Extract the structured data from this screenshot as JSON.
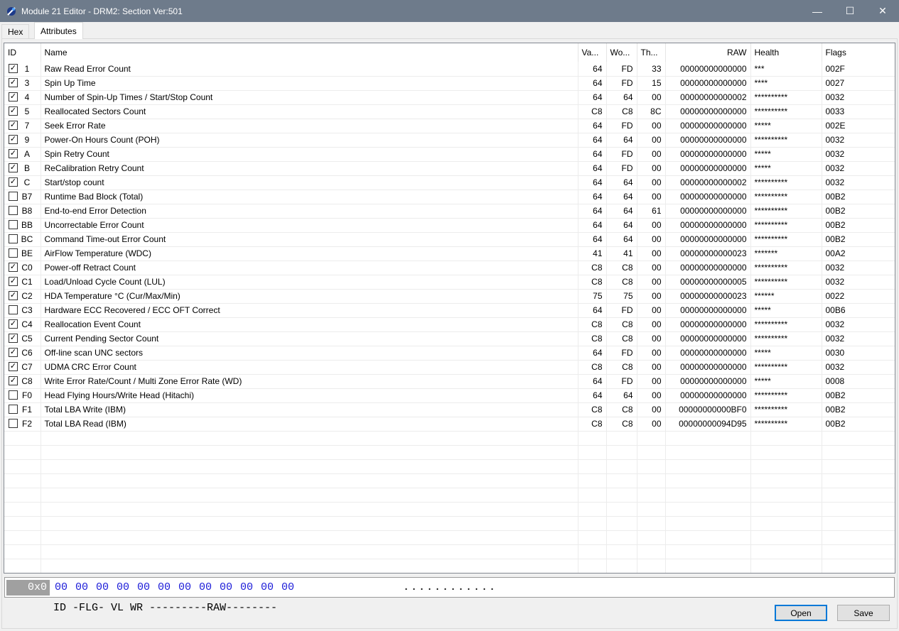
{
  "window": {
    "title": "Module 21 Editor - DRM2: Section Ver:501",
    "minimize": "—",
    "maximize": "☐",
    "close": "✕"
  },
  "tabs": [
    {
      "label": "Hex",
      "active": false
    },
    {
      "label": "Attributes",
      "active": true
    }
  ],
  "columns": {
    "id": "ID",
    "name": "Name",
    "value": "Va...",
    "worst": "Wo...",
    "threshold": "Th...",
    "raw": "RAW",
    "health": "Health",
    "flags": "Flags"
  },
  "rows": [
    {
      "checked": true,
      "id": "1",
      "name": "Raw Read Error Count",
      "va": "64",
      "wo": "FD",
      "th": "33",
      "raw": "00000000000000",
      "health": "***",
      "flags": "002F"
    },
    {
      "checked": true,
      "id": "3",
      "name": "Spin Up Time",
      "va": "64",
      "wo": "FD",
      "th": "15",
      "raw": "00000000000000",
      "health": "****",
      "flags": "0027"
    },
    {
      "checked": true,
      "id": "4",
      "name": "Number of Spin-Up Times / Start/Stop Count",
      "va": "64",
      "wo": "64",
      "th": "00",
      "raw": "00000000000002",
      "health": "**********",
      "flags": "0032"
    },
    {
      "checked": true,
      "id": "5",
      "name": "Reallocated Sectors Count",
      "va": "C8",
      "wo": "C8",
      "th": "8C",
      "raw": "00000000000000",
      "health": "**********",
      "flags": "0033"
    },
    {
      "checked": true,
      "id": "7",
      "name": "Seek Error Rate",
      "va": "64",
      "wo": "FD",
      "th": "00",
      "raw": "00000000000000",
      "health": "*****",
      "flags": "002E"
    },
    {
      "checked": true,
      "id": "9",
      "name": "Power-On Hours Count (POH)",
      "va": "64",
      "wo": "64",
      "th": "00",
      "raw": "00000000000000",
      "health": "**********",
      "flags": "0032"
    },
    {
      "checked": true,
      "id": "A",
      "name": "Spin Retry Count",
      "va": "64",
      "wo": "FD",
      "th": "00",
      "raw": "00000000000000",
      "health": "*****",
      "flags": "0032"
    },
    {
      "checked": true,
      "id": "B",
      "name": "ReCalibration Retry Count",
      "va": "64",
      "wo": "FD",
      "th": "00",
      "raw": "00000000000000",
      "health": "*****",
      "flags": "0032"
    },
    {
      "checked": true,
      "id": "C",
      "name": "Start/stop count",
      "va": "64",
      "wo": "64",
      "th": "00",
      "raw": "00000000000002",
      "health": "**********",
      "flags": "0032"
    },
    {
      "checked": false,
      "id": "B7",
      "name": "Runtime Bad Block (Total)",
      "va": "64",
      "wo": "64",
      "th": "00",
      "raw": "00000000000000",
      "health": "**********",
      "flags": "00B2"
    },
    {
      "checked": false,
      "id": "B8",
      "name": "End-to-end Error Detection",
      "va": "64",
      "wo": "64",
      "th": "61",
      "raw": "00000000000000",
      "health": "**********",
      "flags": "00B2"
    },
    {
      "checked": false,
      "id": "BB",
      "name": "Uncorrectable Error Count",
      "va": "64",
      "wo": "64",
      "th": "00",
      "raw": "00000000000000",
      "health": "**********",
      "flags": "00B2"
    },
    {
      "checked": false,
      "id": "BC",
      "name": "Command Time-out Error Count",
      "va": "64",
      "wo": "64",
      "th": "00",
      "raw": "00000000000000",
      "health": "**********",
      "flags": "00B2"
    },
    {
      "checked": false,
      "id": "BE",
      "name": "AirFlow Temperature (WDC)",
      "va": "41",
      "wo": "41",
      "th": "00",
      "raw": "00000000000023",
      "health": "*******",
      "flags": "00A2"
    },
    {
      "checked": true,
      "id": "C0",
      "name": "Power-off Retract Count",
      "va": "C8",
      "wo": "C8",
      "th": "00",
      "raw": "00000000000000",
      "health": "**********",
      "flags": "0032"
    },
    {
      "checked": true,
      "id": "C1",
      "name": "Load/Unload Cycle Count (LUL)",
      "va": "C8",
      "wo": "C8",
      "th": "00",
      "raw": "00000000000005",
      "health": "**********",
      "flags": "0032"
    },
    {
      "checked": true,
      "id": "C2",
      "name": "HDA Temperature °C (Cur/Max/Min)",
      "va": "75",
      "wo": "75",
      "th": "00",
      "raw": "00000000000023",
      "health": "******",
      "flags": "0022"
    },
    {
      "checked": false,
      "id": "C3",
      "name": "Hardware ECC Recovered / ECC OFT Correct",
      "va": "64",
      "wo": "FD",
      "th": "00",
      "raw": "00000000000000",
      "health": "*****",
      "flags": "00B6"
    },
    {
      "checked": true,
      "id": "C4",
      "name": "Reallocation Event Count",
      "va": "C8",
      "wo": "C8",
      "th": "00",
      "raw": "00000000000000",
      "health": "**********",
      "flags": "0032"
    },
    {
      "checked": true,
      "id": "C5",
      "name": "Current Pending Sector Count",
      "va": "C8",
      "wo": "C8",
      "th": "00",
      "raw": "00000000000000",
      "health": "**********",
      "flags": "0032"
    },
    {
      "checked": true,
      "id": "C6",
      "name": "Off-line scan UNC sectors",
      "va": "64",
      "wo": "FD",
      "th": "00",
      "raw": "00000000000000",
      "health": "*****",
      "flags": "0030"
    },
    {
      "checked": true,
      "id": "C7",
      "name": "UDMA CRC Error Count",
      "va": "C8",
      "wo": "C8",
      "th": "00",
      "raw": "00000000000000",
      "health": "**********",
      "flags": "0032"
    },
    {
      "checked": true,
      "id": "C8",
      "name": "Write Error Rate/Count / Multi Zone Error Rate (WD)",
      "va": "64",
      "wo": "FD",
      "th": "00",
      "raw": "00000000000000",
      "health": "*****",
      "flags": "0008"
    },
    {
      "checked": false,
      "id": "F0",
      "name": "Head Flying Hours/Write Head (Hitachi)",
      "va": "64",
      "wo": "64",
      "th": "00",
      "raw": "00000000000000",
      "health": "**********",
      "flags": "00B2"
    },
    {
      "checked": false,
      "id": "F1",
      "name": "Total LBA Write (IBM)",
      "va": "C8",
      "wo": "C8",
      "th": "00",
      "raw": "00000000000BF0",
      "health": "**********",
      "flags": "00B2"
    },
    {
      "checked": false,
      "id": "F2",
      "name": "Total LBA Read (IBM)",
      "va": "C8",
      "wo": "C8",
      "th": "00",
      "raw": "00000000094D95",
      "health": "**********",
      "flags": "00B2"
    }
  ],
  "empty_rows": 10,
  "hexview": {
    "offset": "0x0",
    "bytes": "00 00 00 00 00 00 00 00 00 00 00 00",
    "ascii": "............"
  },
  "legend": "ID -FLG- VL WR ---------RAW--------",
  "buttons": {
    "open": "Open",
    "save": "Save"
  }
}
